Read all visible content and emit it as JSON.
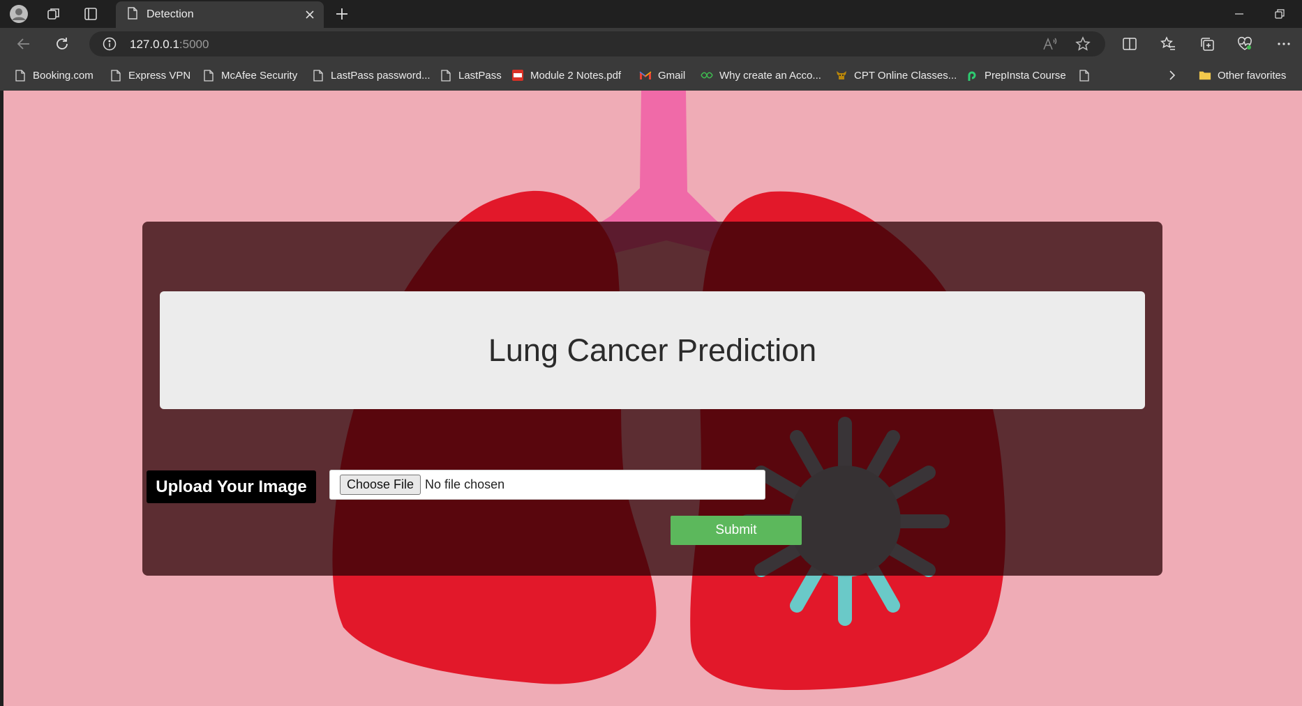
{
  "browser": {
    "tab": {
      "title": "Detection"
    },
    "address": {
      "host": "127.0.0.1",
      "port": ":5000"
    },
    "favorites": [
      {
        "label": "Booking.com",
        "icon": "page-icon"
      },
      {
        "label": "Express VPN",
        "icon": "page-icon"
      },
      {
        "label": "McAfee Security",
        "icon": "page-icon"
      },
      {
        "label": "LastPass password...",
        "icon": "page-icon"
      },
      {
        "label": "LastPass",
        "icon": "page-icon"
      },
      {
        "label": "Module 2 Notes.pdf",
        "icon": "pdf-icon"
      },
      {
        "label": "Gmail",
        "icon": "gmail-icon"
      },
      {
        "label": "Why create an Acco...",
        "icon": "leaf-icon"
      },
      {
        "label": "CPT Online Classes...",
        "icon": "cow-icon"
      },
      {
        "label": "PrepInsta Course",
        "icon": "prepinsta-icon"
      }
    ],
    "other_favorites": "Other favorites"
  },
  "page": {
    "heading": "Lung Cancer Prediction",
    "upload_label": "Upload Your Image",
    "file_button": "Choose File",
    "file_status": "No file chosen",
    "submit_label": "Submit"
  },
  "colors": {
    "page_background": "#efacb6",
    "card_overlay": "rgba(40,0,4,0.74)",
    "submit_button": "#5cb85c"
  }
}
